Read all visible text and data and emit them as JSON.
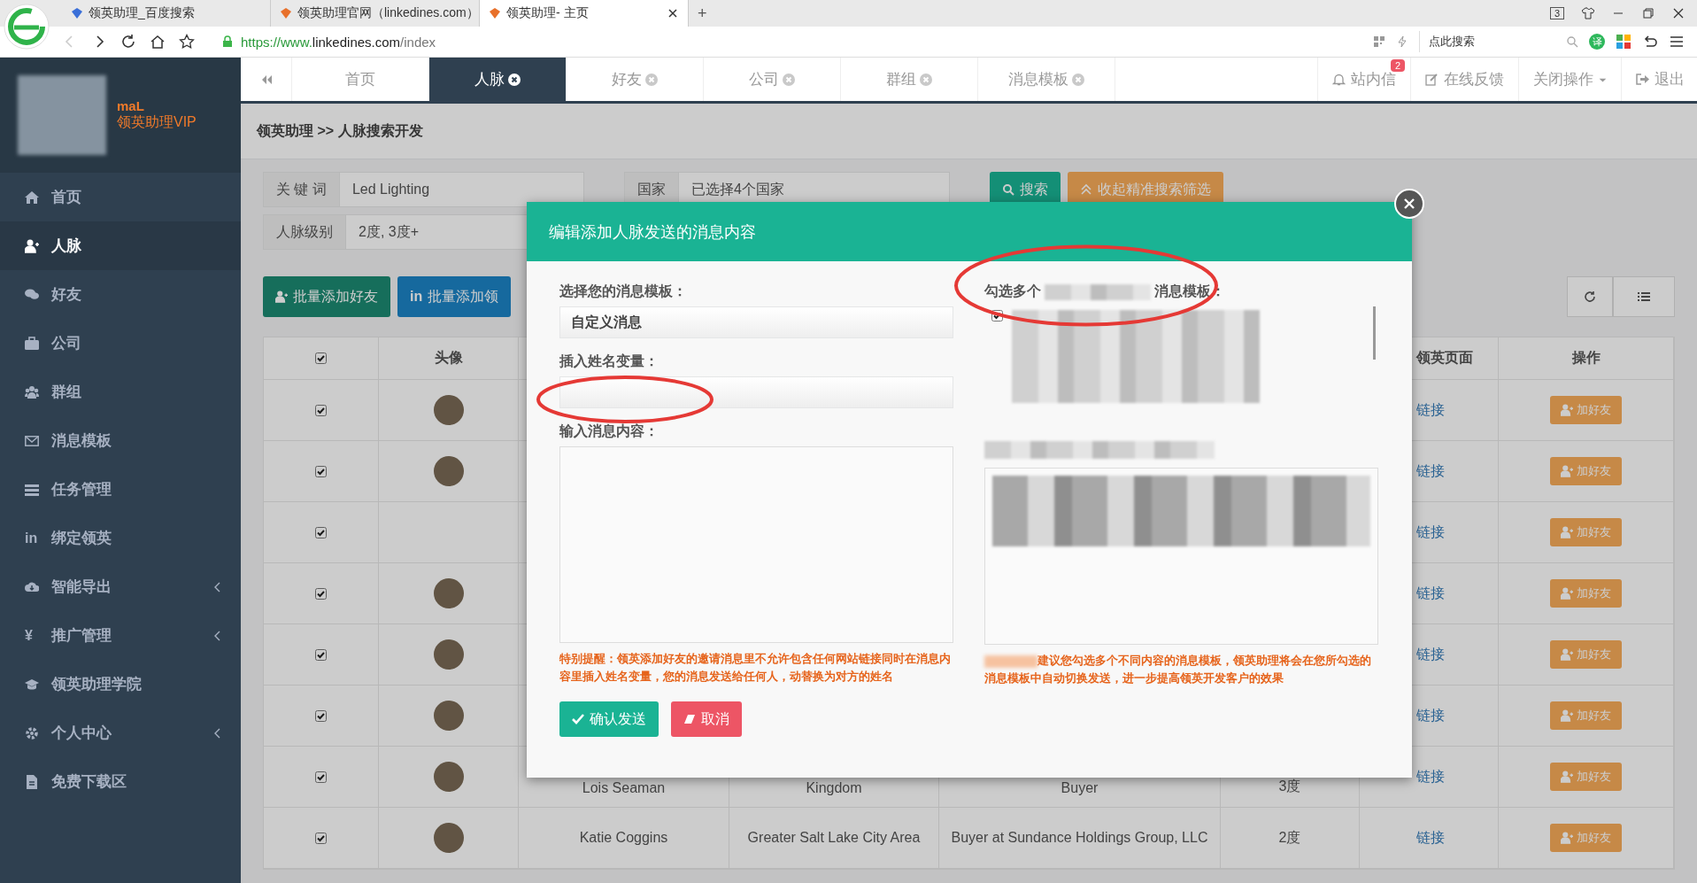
{
  "browser": {
    "tabs": [
      {
        "title": "领英助理_百度搜索",
        "selected": false
      },
      {
        "title": "领英助理官网（linkedines.com）",
        "selected": false
      },
      {
        "title": "领英助理- 主页",
        "selected": true
      }
    ],
    "new_tab": "+",
    "window_count": "3",
    "url_scheme": "https://www.",
    "url_domain": "linkedines.com",
    "url_path": "/index",
    "search_placeholder": "点此搜索",
    "translate": "译"
  },
  "sidebar": {
    "user_name": "maL",
    "user_level": "领英助理VIP",
    "items": [
      {
        "label": "首页",
        "selected": false,
        "has_submenu": false
      },
      {
        "label": "人脉",
        "selected": true,
        "has_submenu": false
      },
      {
        "label": "好友",
        "selected": false,
        "has_submenu": false
      },
      {
        "label": "公司",
        "selected": false,
        "has_submenu": false
      },
      {
        "label": "群组",
        "selected": false,
        "has_submenu": false
      },
      {
        "label": "消息模板",
        "selected": false,
        "has_submenu": false
      },
      {
        "label": "任务管理",
        "selected": false,
        "has_submenu": false
      },
      {
        "label": "绑定领英",
        "glyph": "in",
        "selected": false,
        "has_submenu": false
      },
      {
        "label": "智能导出",
        "selected": false,
        "has_submenu": true
      },
      {
        "label": "推广管理",
        "glyph": "¥",
        "selected": false,
        "has_submenu": true
      },
      {
        "label": "领英助理学院",
        "selected": false,
        "has_submenu": false
      },
      {
        "label": "个人中心",
        "selected": false,
        "has_submenu": true
      },
      {
        "label": "免费下载区",
        "selected": false,
        "has_submenu": false
      }
    ]
  },
  "top_tabs": [
    {
      "label": "首页",
      "selected": false,
      "closable": false
    },
    {
      "label": "人脉",
      "selected": true,
      "closable": true
    },
    {
      "label": "好友",
      "selected": false,
      "closable": true
    },
    {
      "label": "公司",
      "selected": false,
      "closable": true
    },
    {
      "label": "群组",
      "selected": false,
      "closable": true
    },
    {
      "label": "消息模板",
      "selected": false,
      "closable": true
    }
  ],
  "top_actions": [
    {
      "label": "站内信",
      "badge": "2"
    },
    {
      "label": "在线反馈"
    },
    {
      "label": "关闭操作"
    },
    {
      "label": "退出"
    }
  ],
  "breadcrumb": "领英助理 >> 人脉搜索开发",
  "search_form": {
    "keyword": {
      "label": "关 键 词",
      "value": "Led Lighting"
    },
    "country": {
      "label": "国家",
      "value": "已选择4个国家"
    },
    "level": {
      "label": "人脉级别",
      "value": "2度, 3度+"
    },
    "search_button": "搜索",
    "collapse_button": "收起精准搜索筛选"
  },
  "batch_buttons": [
    {
      "label": "批量添加好友"
    },
    {
      "label": "批量添加领",
      "glyph": "in"
    }
  ],
  "table": {
    "header_checked": true,
    "columns": {
      "avatar": "头像",
      "profile": "领英页面",
      "action": "操作"
    },
    "rows": [
      {
        "checked": true,
        "avatar": true,
        "link": "链接",
        "action": "加好友"
      },
      {
        "checked": true,
        "avatar": true,
        "link": "链接",
        "action": "加好友"
      },
      {
        "checked": true,
        "avatar": false,
        "link": "链接",
        "action": "加好友"
      },
      {
        "checked": true,
        "avatar": true,
        "link": "链接",
        "action": "加好友"
      },
      {
        "checked": true,
        "avatar": true,
        "link": "链接",
        "action": "加好友"
      },
      {
        "checked": true,
        "avatar": true,
        "link": "链接",
        "action": "加好友"
      },
      {
        "checked": true,
        "avatar": true,
        "name": "Lois Seaman",
        "location": "Kingdom",
        "title": "Buyer",
        "degree": "3度",
        "link": "链接",
        "action": "加好友"
      },
      {
        "checked": true,
        "avatar": true,
        "name": "Katie Coggins",
        "location": "Greater Salt Lake City Area",
        "title": "Buyer at Sundance Holdings Group, LLC",
        "degree": "2度",
        "link": "链接",
        "action": "加好友"
      }
    ]
  },
  "modal": {
    "title": "编辑添加人脉发送的消息内容",
    "template_label": "选择您的消息模板：",
    "template_value": "自定义消息",
    "variable_label": "插入姓名变量：",
    "content_label": "输入消息内容：",
    "multi_label_start": "勾选多个",
    "multi_label_end": "消息模板：",
    "multi_checked": true,
    "note_left": "特别提醒：领英添加好友的邀请消息里不允许包含任何网站链接同时在消息内容里插入姓名变量，您的消息发送给任何人，动替换为对方的姓名",
    "note_right": "建议您勾选多个不同内容的消息模板，领英助理将会在您所勾选的消息模板中自动切换发送，进一步提高领英开发客户的效果",
    "confirm_button": "确认发送",
    "cancel_button": "取消"
  }
}
